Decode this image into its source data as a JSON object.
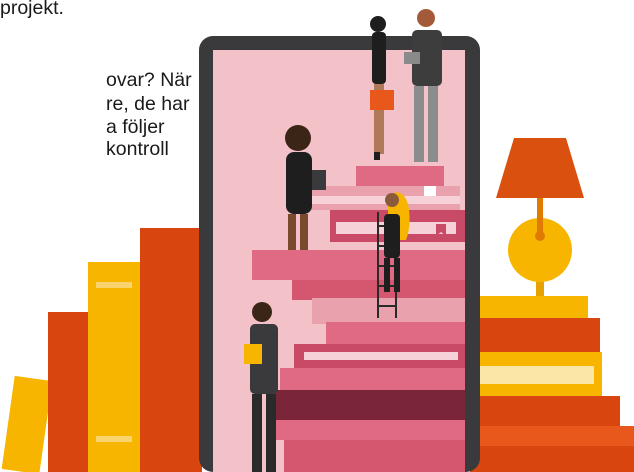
{
  "text_lines": [
    "projekt.",
    "ovar? När",
    "re, de har",
    "a följer",
    "kontroll",
    ""
  ],
  "colors": {
    "tablet_frame": "#3a3a3c",
    "tablet_screen": "#f2bcc4",
    "book_pink": "#e06a84",
    "book_dark": "#7a2638",
    "book_orange": "#e8581c",
    "book_yellow": "#f7b500",
    "lamp_shade": "#d9500f",
    "lamp_base": "#f7b500"
  },
  "icons": [
    "bookmark-icon",
    "bookmark-icon",
    "bookmark-icon"
  ]
}
